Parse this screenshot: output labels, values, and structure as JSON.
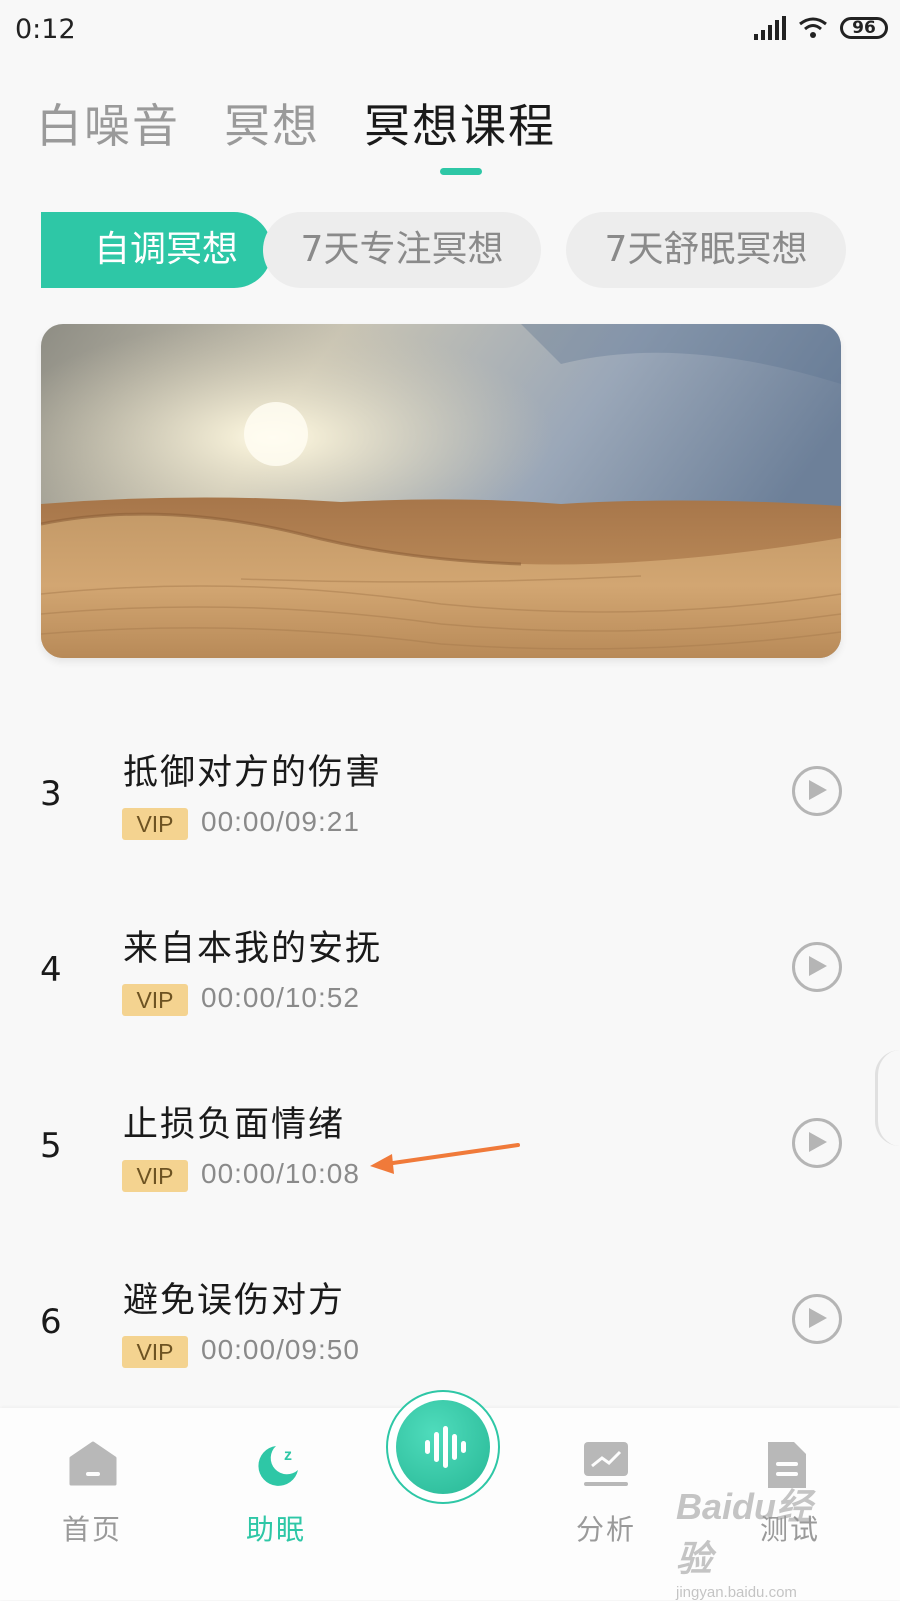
{
  "status": {
    "time": "0:12",
    "battery": "96"
  },
  "tabs": [
    {
      "label": "白噪音",
      "active": false
    },
    {
      "label": "冥想",
      "active": false
    },
    {
      "label": "冥想课程",
      "active": true
    }
  ],
  "chips": [
    {
      "label": "自调冥想",
      "active": true
    },
    {
      "label": "7天专注冥想",
      "active": false
    },
    {
      "label": "7天舒眠冥想",
      "active": false
    }
  ],
  "banner": {
    "icon": "desert-sunset-image"
  },
  "tracks": [
    {
      "num": "3",
      "title": "抵御对方的伤害",
      "badge": "VIP",
      "duration": "00:00/09:21"
    },
    {
      "num": "4",
      "title": "来自本我的安抚",
      "badge": "VIP",
      "duration": "00:00/10:52"
    },
    {
      "num": "5",
      "title": "止损负面情绪",
      "badge": "VIP",
      "duration": "00:00/10:08"
    },
    {
      "num": "6",
      "title": "避免误伤对方",
      "badge": "VIP",
      "duration": "00:00/09:50"
    }
  ],
  "nav": [
    {
      "label": "首页",
      "icon": "home-icon",
      "active": false
    },
    {
      "label": "助眠",
      "icon": "moon-icon",
      "active": true
    },
    {
      "label": "分析",
      "icon": "chart-icon",
      "active": false
    },
    {
      "label": "测试",
      "icon": "document-icon",
      "active": false
    }
  ],
  "watermark": {
    "line1": "Baidu经验",
    "line2": "jingyan.baidu.com"
  },
  "colors": {
    "accent": "#2ec7a6",
    "vip": "#f4d390",
    "annotation": "#f07a3a"
  }
}
